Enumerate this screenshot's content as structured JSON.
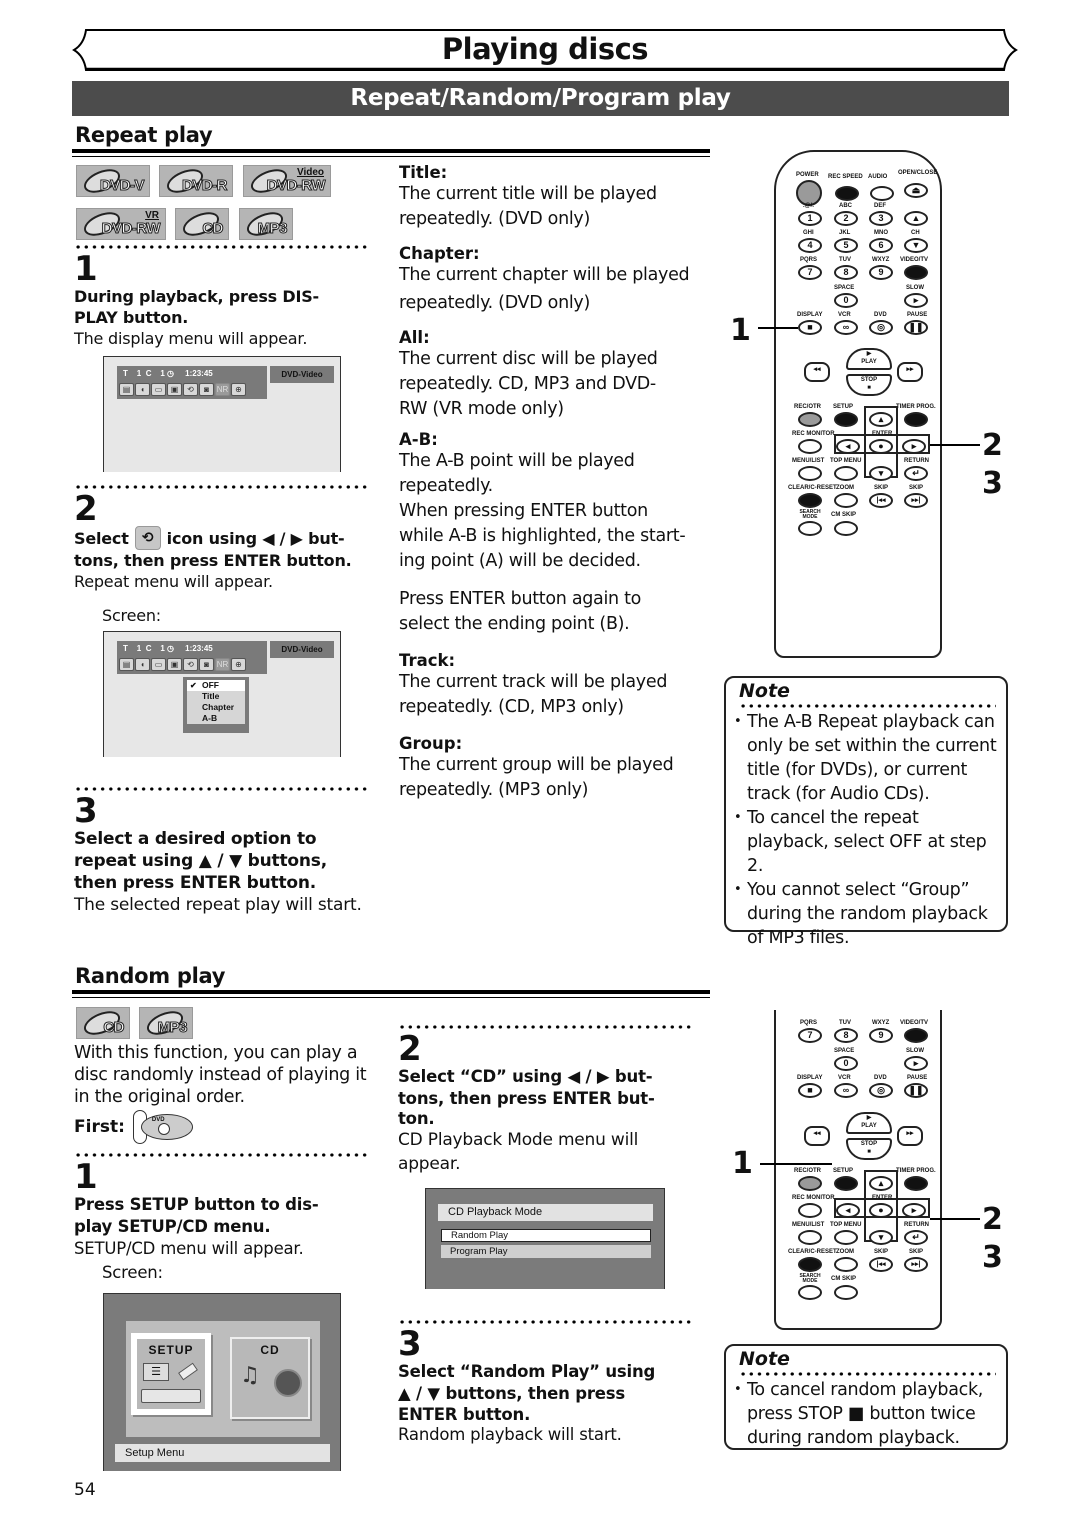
{
  "page": {
    "title": "Playing discs",
    "subtitle": "Repeat/Random/Program play",
    "page_number": "54"
  },
  "repeat": {
    "heading": "Repeat play",
    "badges": [
      {
        "label": "DVD-V",
        "sup": ""
      },
      {
        "label": "DVD-R",
        "sup": ""
      },
      {
        "label": "DVD-RW",
        "sup": "Video"
      },
      {
        "label": "DVD-RW",
        "sup": "VR"
      },
      {
        "label": "CD",
        "sup": ""
      },
      {
        "label": "MP3",
        "sup": ""
      }
    ],
    "steps": [
      {
        "num": "1",
        "bold_lines": [
          "During playback, press DIS-",
          "PLAY button."
        ],
        "text": "The display menu will appear."
      },
      {
        "num": "2",
        "bold_pre": "Select",
        "bold_mid": "icon using ◀ / ▶ but-",
        "bold_line2": "tons, then press ENTER button.",
        "text": "Repeat menu will appear.",
        "screen_label": "Screen:"
      },
      {
        "num": "3",
        "bold_lines": [
          "Select a desired option to",
          "repeat using ▲ / ▼ buttons,",
          "then press ENTER button."
        ],
        "text": "The selected repeat play will start."
      }
    ],
    "osd": {
      "title_label": "T",
      "title_num": "1",
      "chapter_label": "C",
      "chapter_num": "1",
      "time": "1:23:45",
      "disc_type": "DVD-Video",
      "icons": [
        "language-icon",
        "audio-icon",
        "subtitle-icon",
        "angle-icon",
        "repeat-icon",
        "marker-icon",
        "nr-icon",
        "zoom-icon"
      ],
      "nr_label": "NR"
    },
    "repeat_menu": {
      "options": [
        "OFF",
        "Title",
        "Chapter",
        "A-B"
      ],
      "selected": "OFF"
    },
    "terms": [
      {
        "term": "Title:",
        "desc": [
          "The current title will be played",
          "repeatedly. (DVD only)"
        ]
      },
      {
        "term": "Chapter:",
        "desc": [
          "The current chapter will be played",
          "repeatedly. (DVD only)"
        ]
      },
      {
        "term": "All:",
        "desc": [
          "The current disc will be played",
          "repeatedly. CD, MP3 and DVD-",
          "RW (VR mode only)"
        ]
      },
      {
        "term": "A-B:",
        "desc": [
          "The A-B point will be played",
          "repeatedly.",
          "When pressing ENTER button",
          "while A-B is highlighted, the start-",
          "ing point (A) will be decided."
        ],
        "extra": [
          "Press ENTER button again to",
          "select the ending point (B)."
        ]
      },
      {
        "term": "Track:",
        "desc": [
          "The current track will be played",
          "repeatedly. (CD, MP3 only)"
        ]
      },
      {
        "term": "Group:",
        "desc": [
          "The current group will be played",
          "repeatedly. (MP3 only)"
        ]
      }
    ],
    "note": {
      "title": "Note",
      "items": [
        "The A-B Repeat playback can only be set within the current title (for DVDs), or current track (for Audio CDs).",
        "To cancel the repeat playback, select OFF at step 2.",
        "You cannot select “Group” during the random playback of MP3 files."
      ]
    },
    "callouts": [
      "1",
      "2",
      "3"
    ]
  },
  "remote": {
    "labels": {
      "power": "POWER",
      "rec_speed": "REC SPEED",
      "audio": "AUDIO",
      "open_close": "OPEN/CLOSE",
      "k1": ".@/:",
      "k2": "ABC",
      "k3": "DEF",
      "k4": "GHI",
      "k5": "JKL",
      "k6": "MNO",
      "k7": "PQRS",
      "k8": "TUV",
      "k9": "WXYZ",
      "video_tv": "VIDEO/TV",
      "space": "SPACE",
      "slow": "SLOW",
      "display": "DISPLAY",
      "vcr": "VCR",
      "dvd": "DVD",
      "pause": "PAUSE",
      "ch": "CH",
      "play": "PLAY",
      "stop": "STOP",
      "rec_otr": "REC/OTR",
      "setup": "SETUP",
      "timer_prog": "TIMER PROG.",
      "rec_monitor": "REC MONITOR",
      "enter": "ENTER",
      "menu_list": "MENU/LIST",
      "top_menu": "TOP MENU",
      "return": "RETURN",
      "clear_reset": "CLEAR/C-RESET",
      "zoom": "ZOOM",
      "skip_back": "SKIP",
      "skip_fwd": "SKIP",
      "search_mode": "SEARCH MODE",
      "cm_skip": "CM SKIP"
    },
    "digits": [
      "1",
      "2",
      "3",
      "4",
      "5",
      "6",
      "7",
      "8",
      "9",
      "0"
    ]
  },
  "random": {
    "heading": "Random play",
    "badges": [
      {
        "label": "CD"
      },
      {
        "label": "MP3"
      }
    ],
    "intro": [
      "With this function, you can play a",
      "disc randomly instead of playing it",
      "in the original order."
    ],
    "first_label": "First:",
    "first_icon_label": "DVD",
    "steps": [
      {
        "num": "1",
        "bold_lines": [
          "Press SETUP button to dis-",
          "play SETUP/CD menu."
        ],
        "text": "SETUP/CD menu will appear.",
        "screen_label": "Screen:"
      },
      {
        "num": "2",
        "bold_lines": [
          "Select “CD” using ◀ / ▶ but-",
          "tons, then press ENTER but-",
          "ton."
        ],
        "text_lines": [
          "CD Playback Mode menu will",
          "appear."
        ]
      },
      {
        "num": "3",
        "bold_lines": [
          "Select “Random Play” using",
          "▲ / ▼ buttons, then press",
          "ENTER button."
        ],
        "text": "Random playback will start."
      }
    ],
    "setup_menu": {
      "tiles": [
        "SETUP",
        "CD"
      ],
      "selected": "SETUP",
      "footer": "Setup Menu"
    },
    "cd_menu": {
      "header": "CD Playback Mode",
      "options": [
        "Random Play",
        "Program Play"
      ],
      "selected": "Random Play"
    },
    "note": {
      "title": "Note",
      "items": [
        "To cancel random playback, press STOP ■ button twice during random playback."
      ]
    },
    "callouts": [
      "1",
      "2",
      "3"
    ]
  }
}
